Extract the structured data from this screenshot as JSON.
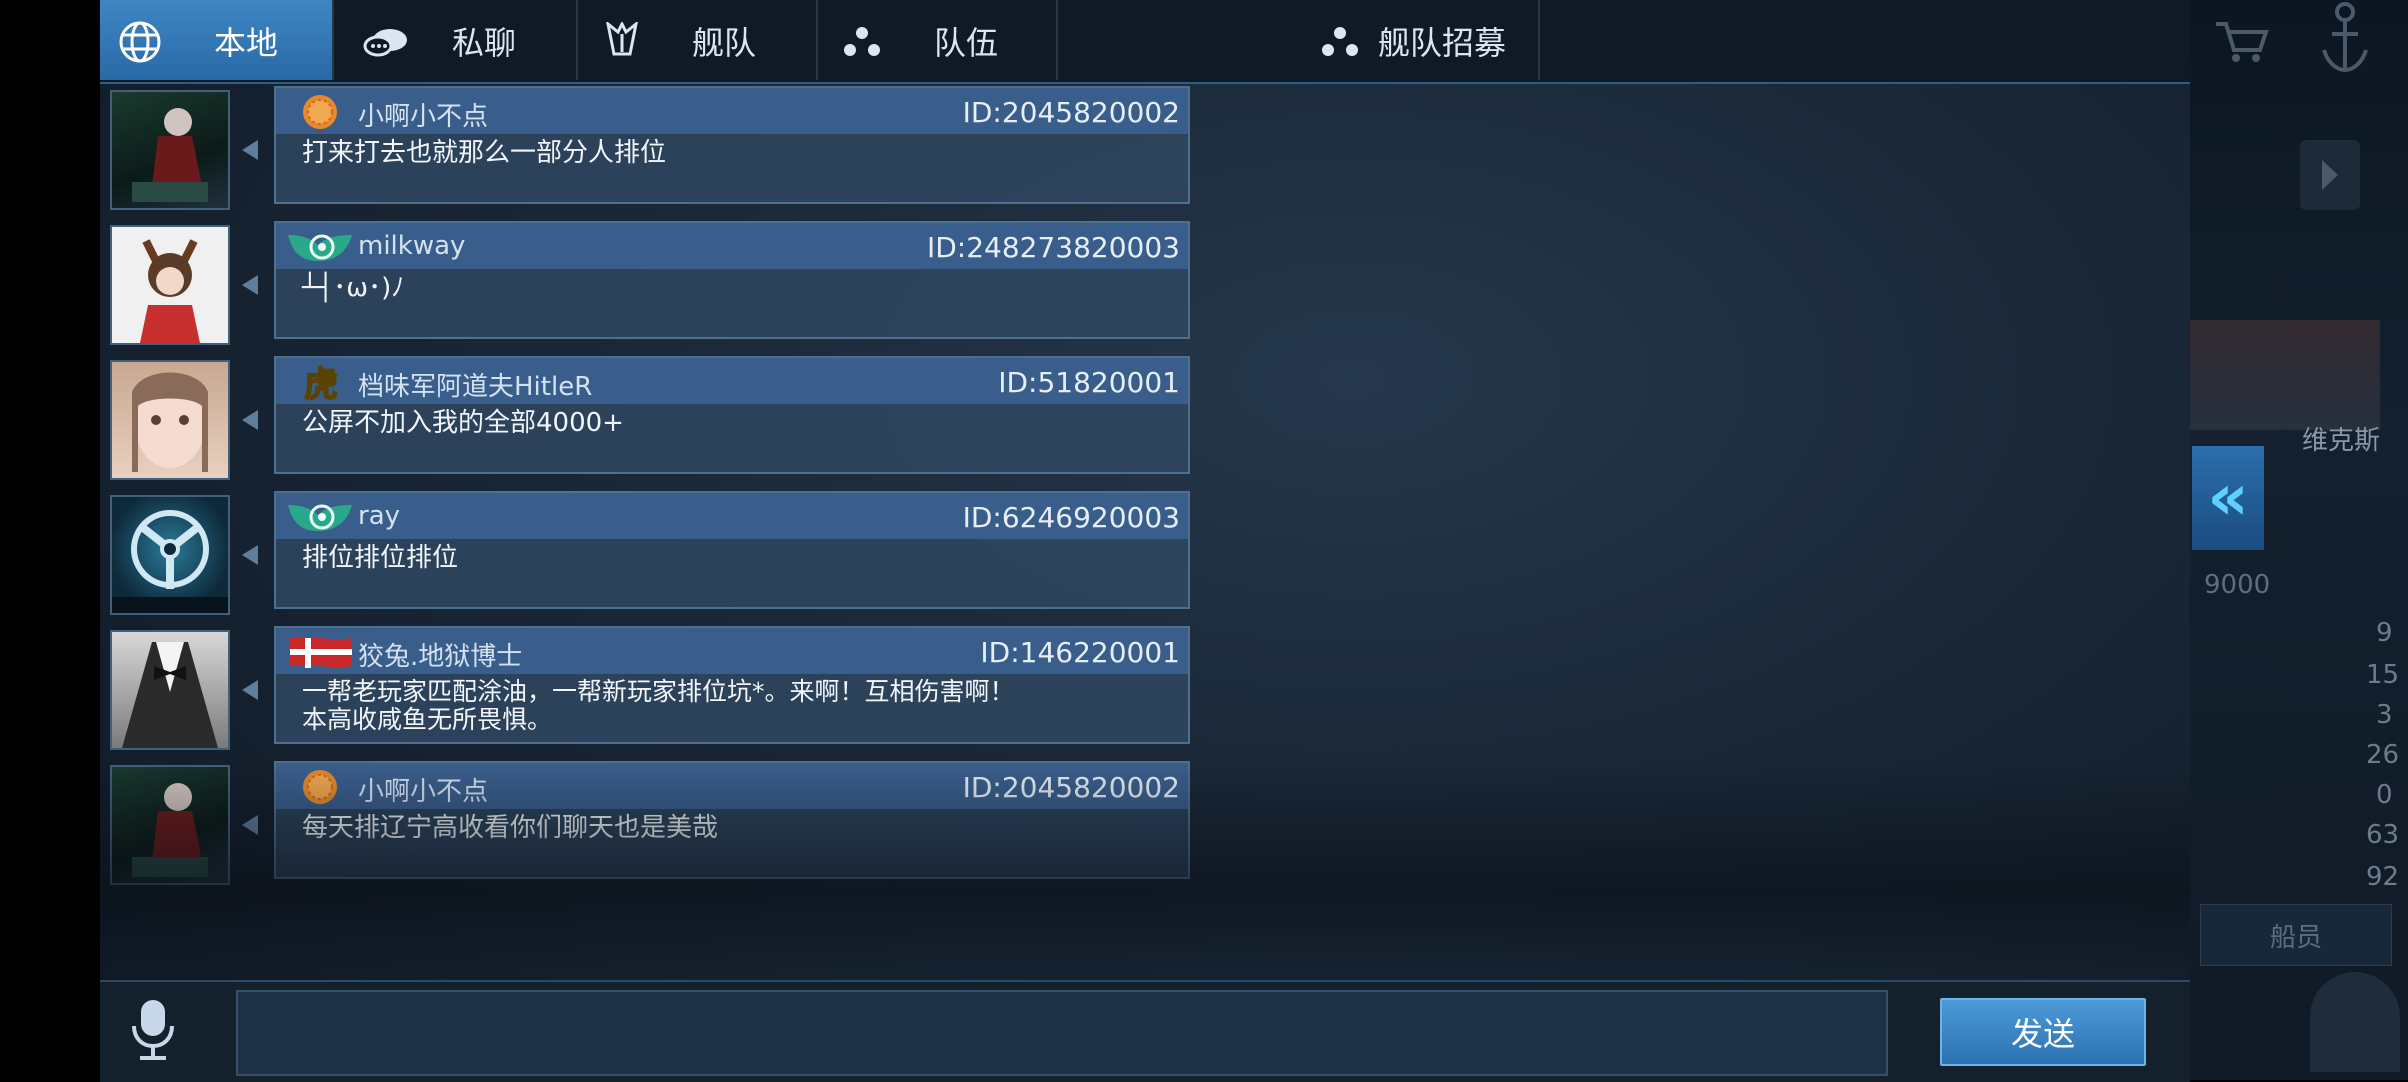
{
  "tabs": [
    {
      "label": "本地",
      "icon": "globe-icon"
    },
    {
      "label": "私聊",
      "icon": "chat-bubble-icon"
    },
    {
      "label": "舰队",
      "icon": "fleet-emblem-icon"
    },
    {
      "label": "队伍",
      "icon": "team-dots-icon"
    },
    {
      "label": "舰队招募",
      "icon": "recruit-dots-icon"
    }
  ],
  "messages": [
    {
      "name": "小啊小不点",
      "id": "ID:2045820002",
      "text": "打来打去也就那么一部分人排位",
      "badge": "orange-coin-badge"
    },
    {
      "name": "milkway",
      "id": "ID:248273820003",
      "text": "┴┤･ω･)ﾉ",
      "badge": "green-wing-badge"
    },
    {
      "name": "档味军阿道夫HitleR",
      "id": "ID:51820001",
      "text": "公屏不加入我的全部4000+",
      "badge": "tiger-badge"
    },
    {
      "name": "ray",
      "id": "ID:6246920003",
      "text": "排位排位排位",
      "badge": "green-wing-badge"
    },
    {
      "name": "狡兔.地狱博士",
      "id": "ID:146220001",
      "text": "一帮老玩家匹配涂油，一帮新玩家排位坑*。来啊！互相伤害啊！\n本高收咸鱼无所畏惧。",
      "badge": "flag-badge"
    },
    {
      "name": "小啊小不点",
      "id": "ID:2045820002",
      "text": "每天排辽宁高收看你们聊天也是美哉",
      "badge": "orange-coin-badge"
    }
  ],
  "input": {
    "placeholder": ""
  },
  "send_label": "发送",
  "side": {
    "partial_name": "维克斯",
    "value": "9000",
    "stats": [
      "9",
      "15",
      "3",
      "26",
      "0",
      "63",
      "92"
    ],
    "crew_label": "船员",
    "collapse_glyph": "«"
  },
  "colors": {
    "tab_active": "#3f86c4",
    "bubble_head": "#3a5e8c",
    "send_button": "#2b71b2"
  }
}
